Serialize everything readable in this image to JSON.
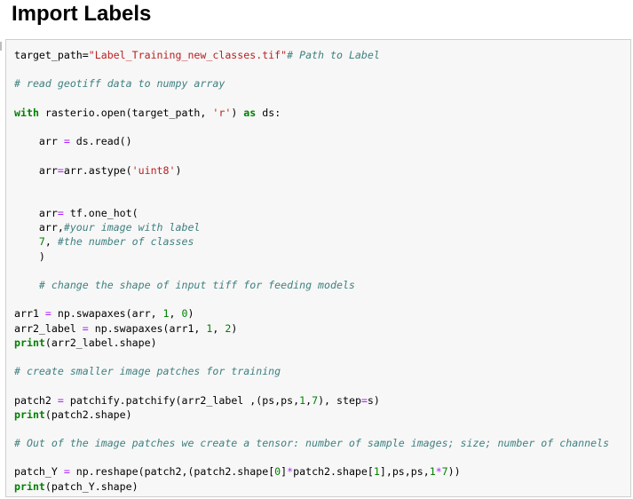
{
  "heading": "Import Labels",
  "code_lines": [
    [
      {
        "t": "target_path=",
        "c": ""
      },
      {
        "t": "\"Label_Training_new_classes.tif\"",
        "c": "str"
      },
      {
        "t": "# Path to Label",
        "c": "cm"
      }
    ],
    [],
    [
      {
        "t": "# read geotiff data to numpy array",
        "c": "cm"
      }
    ],
    [],
    [
      {
        "t": "with",
        "c": "kw"
      },
      {
        "t": " rasterio.open(target_path, ",
        "c": ""
      },
      {
        "t": "'r'",
        "c": "str"
      },
      {
        "t": ") ",
        "c": ""
      },
      {
        "t": "as",
        "c": "kw"
      },
      {
        "t": " ds:",
        "c": ""
      }
    ],
    [],
    [
      {
        "t": "    arr ",
        "c": ""
      },
      {
        "t": "=",
        "c": "op"
      },
      {
        "t": " ds.read()",
        "c": ""
      }
    ],
    [],
    [
      {
        "t": "    arr",
        "c": ""
      },
      {
        "t": "=",
        "c": "op"
      },
      {
        "t": "arr.astype(",
        "c": ""
      },
      {
        "t": "'uint8'",
        "c": "str"
      },
      {
        "t": ")",
        "c": ""
      }
    ],
    [],
    [],
    [
      {
        "t": "    arr",
        "c": ""
      },
      {
        "t": "=",
        "c": "op"
      },
      {
        "t": " tf.one_hot(",
        "c": ""
      }
    ],
    [
      {
        "t": "    arr,",
        "c": ""
      },
      {
        "t": "#your image with label",
        "c": "cm"
      }
    ],
    [
      {
        "t": "    ",
        "c": ""
      },
      {
        "t": "7",
        "c": "num"
      },
      {
        "t": ", ",
        "c": ""
      },
      {
        "t": "#the number of classes",
        "c": "cm"
      }
    ],
    [
      {
        "t": "    )",
        "c": ""
      }
    ],
    [],
    [
      {
        "t": "    ",
        "c": ""
      },
      {
        "t": "# change the shape of input tiff for feeding models",
        "c": "cm"
      }
    ],
    [],
    [
      {
        "t": "arr1 ",
        "c": ""
      },
      {
        "t": "=",
        "c": "op"
      },
      {
        "t": " np.swapaxes(arr, ",
        "c": ""
      },
      {
        "t": "1",
        "c": "num"
      },
      {
        "t": ", ",
        "c": ""
      },
      {
        "t": "0",
        "c": "num"
      },
      {
        "t": ")",
        "c": ""
      }
    ],
    [
      {
        "t": "arr2_label ",
        "c": ""
      },
      {
        "t": "=",
        "c": "op"
      },
      {
        "t": " np.swapaxes(arr1, ",
        "c": ""
      },
      {
        "t": "1",
        "c": "num"
      },
      {
        "t": ", ",
        "c": ""
      },
      {
        "t": "2",
        "c": "num"
      },
      {
        "t": ")",
        "c": ""
      }
    ],
    [
      {
        "t": "print",
        "c": "kw"
      },
      {
        "t": "(arr2_label.shape)",
        "c": ""
      }
    ],
    [],
    [
      {
        "t": "# create smaller image patches for training",
        "c": "cm"
      }
    ],
    [],
    [
      {
        "t": "patch2 ",
        "c": ""
      },
      {
        "t": "=",
        "c": "op"
      },
      {
        "t": " patchify.patchify(arr2_label ,(ps,ps,",
        "c": ""
      },
      {
        "t": "1",
        "c": "num"
      },
      {
        "t": ",",
        "c": ""
      },
      {
        "t": "7",
        "c": "num"
      },
      {
        "t": "), step",
        "c": ""
      },
      {
        "t": "=",
        "c": "op"
      },
      {
        "t": "s)",
        "c": ""
      }
    ],
    [
      {
        "t": "print",
        "c": "kw"
      },
      {
        "t": "(patch2.shape)",
        "c": ""
      }
    ],
    [],
    [
      {
        "t": "# Out of the image patches we create a tensor: number of sample images; size; number of channels",
        "c": "cm"
      }
    ],
    [],
    [
      {
        "t": "patch_Y ",
        "c": ""
      },
      {
        "t": "=",
        "c": "op"
      },
      {
        "t": " np.reshape(patch2,(patch2.shape[",
        "c": ""
      },
      {
        "t": "0",
        "c": "num"
      },
      {
        "t": "]",
        "c": ""
      },
      {
        "t": "*",
        "c": "op"
      },
      {
        "t": "patch2.shape[",
        "c": ""
      },
      {
        "t": "1",
        "c": "num"
      },
      {
        "t": "],ps,ps,",
        "c": ""
      },
      {
        "t": "1",
        "c": "num"
      },
      {
        "t": "*",
        "c": "op"
      },
      {
        "t": "7",
        "c": "num"
      },
      {
        "t": "))",
        "c": ""
      }
    ],
    [
      {
        "t": "print",
        "c": "kw"
      },
      {
        "t": "(patch_Y.shape)",
        "c": ""
      }
    ]
  ]
}
